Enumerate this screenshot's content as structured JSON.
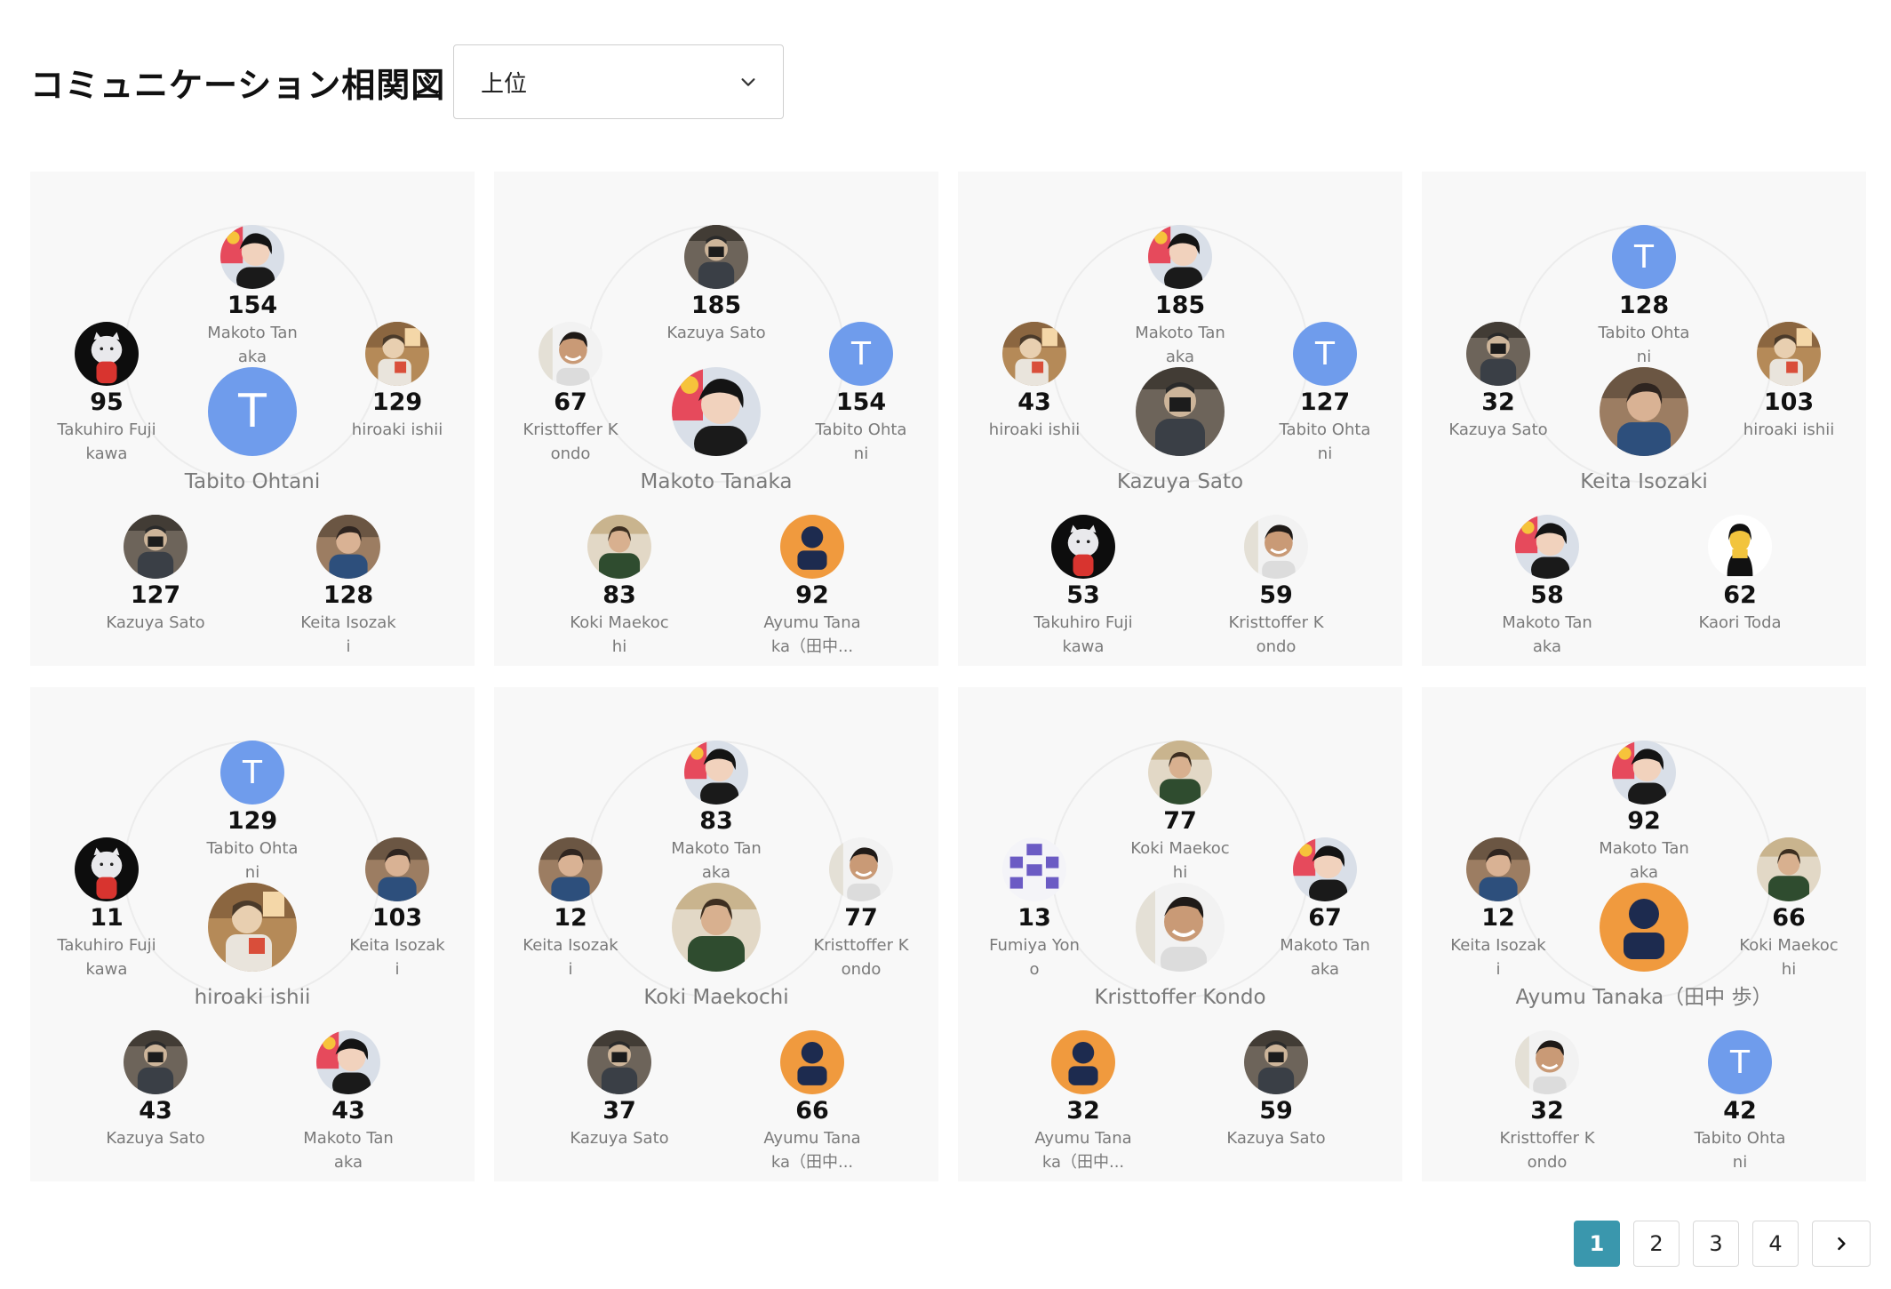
{
  "header": {
    "title": "コミュニケーション相関図",
    "select_value": "上位"
  },
  "cards": [
    {
      "center": {
        "name": "Tabito Ohtani",
        "avatar": "letter-T"
      },
      "nodes": [
        {
          "count": "154",
          "name": "Makoto Tanaka",
          "avatar": "photo-makoto"
        },
        {
          "count": "129",
          "name": "hiroaki ishii",
          "avatar": "photo-hiroaki"
        },
        {
          "count": "128",
          "name": "Keita Isozaki",
          "avatar": "photo-keita"
        },
        {
          "count": "127",
          "name": "Kazuya Sato",
          "avatar": "photo-kazuya"
        },
        {
          "count": "95",
          "name": "Takuhiro Fujikawa",
          "avatar": "photo-takuhiro"
        }
      ]
    },
    {
      "center": {
        "name": "Makoto Tanaka",
        "avatar": "photo-makoto"
      },
      "nodes": [
        {
          "count": "185",
          "name": "Kazuya Sato",
          "avatar": "photo-kazuya"
        },
        {
          "count": "154",
          "name": "Tabito Ohtani",
          "avatar": "letter-T"
        },
        {
          "count": "92",
          "name": "Ayumu Tanaka（田中...",
          "avatar": "person-orange"
        },
        {
          "count": "83",
          "name": "Koki Maekochi",
          "avatar": "photo-koki"
        },
        {
          "count": "67",
          "name": "Kristtoffer Kondo",
          "avatar": "photo-kristtoffer"
        }
      ]
    },
    {
      "center": {
        "name": "Kazuya Sato",
        "avatar": "photo-kazuya"
      },
      "nodes": [
        {
          "count": "185",
          "name": "Makoto Tanaka",
          "avatar": "photo-makoto"
        },
        {
          "count": "127",
          "name": "Tabito Ohtani",
          "avatar": "letter-T"
        },
        {
          "count": "59",
          "name": "Kristtoffer Kondo",
          "avatar": "photo-kristtoffer"
        },
        {
          "count": "53",
          "name": "Takuhiro Fujikawa",
          "avatar": "photo-takuhiro"
        },
        {
          "count": "43",
          "name": "hiroaki ishii",
          "avatar": "photo-hiroaki"
        }
      ]
    },
    {
      "center": {
        "name": "Keita Isozaki",
        "avatar": "photo-keita"
      },
      "nodes": [
        {
          "count": "128",
          "name": "Tabito Ohtani",
          "avatar": "letter-T"
        },
        {
          "count": "103",
          "name": "hiroaki ishii",
          "avatar": "photo-hiroaki"
        },
        {
          "count": "62",
          "name": "Kaori Toda",
          "avatar": "photo-kaori"
        },
        {
          "count": "58",
          "name": "Makoto Tanaka",
          "avatar": "photo-makoto"
        },
        {
          "count": "32",
          "name": "Kazuya Sato",
          "avatar": "photo-kazuya"
        }
      ]
    },
    {
      "center": {
        "name": "hiroaki ishii",
        "avatar": "photo-hiroaki"
      },
      "nodes": [
        {
          "count": "129",
          "name": "Tabito Ohtani",
          "avatar": "letter-T"
        },
        {
          "count": "103",
          "name": "Keita Isozaki",
          "avatar": "photo-keita"
        },
        {
          "count": "43",
          "name": "Makoto Tanaka",
          "avatar": "photo-makoto"
        },
        {
          "count": "43",
          "name": "Kazuya Sato",
          "avatar": "photo-kazuya"
        },
        {
          "count": "11",
          "name": "Takuhiro Fujikawa",
          "avatar": "photo-takuhiro"
        }
      ]
    },
    {
      "center": {
        "name": "Koki Maekochi",
        "avatar": "photo-koki"
      },
      "nodes": [
        {
          "count": "83",
          "name": "Makoto Tanaka",
          "avatar": "photo-makoto"
        },
        {
          "count": "77",
          "name": "Kristtoffer Kondo",
          "avatar": "photo-kristtoffer"
        },
        {
          "count": "66",
          "name": "Ayumu Tanaka（田中...",
          "avatar": "person-orange"
        },
        {
          "count": "37",
          "name": "Kazuya Sato",
          "avatar": "photo-kazuya"
        },
        {
          "count": "12",
          "name": "Keita Isozaki",
          "avatar": "photo-keita"
        }
      ]
    },
    {
      "center": {
        "name": "Kristtoffer Kondo",
        "avatar": "photo-kristtoffer"
      },
      "nodes": [
        {
          "count": "77",
          "name": "Koki Maekochi",
          "avatar": "photo-koki"
        },
        {
          "count": "67",
          "name": "Makoto Tanaka",
          "avatar": "photo-makoto"
        },
        {
          "count": "59",
          "name": "Kazuya Sato",
          "avatar": "photo-kazuya"
        },
        {
          "count": "32",
          "name": "Ayumu Tanaka（田中...",
          "avatar": "person-orange"
        },
        {
          "count": "13",
          "name": "Fumiya Yono",
          "avatar": "pattern-purple"
        }
      ]
    },
    {
      "center": {
        "name": "Ayumu Tanaka（田中 歩）",
        "avatar": "person-orange"
      },
      "nodes": [
        {
          "count": "92",
          "name": "Makoto Tanaka",
          "avatar": "photo-makoto"
        },
        {
          "count": "66",
          "name": "Koki Maekochi",
          "avatar": "photo-koki"
        },
        {
          "count": "42",
          "name": "Tabito Ohtani",
          "avatar": "letter-T"
        },
        {
          "count": "32",
          "name": "Kristtoffer Kondo",
          "avatar": "photo-kristtoffer"
        },
        {
          "count": "12",
          "name": "Keita Isozaki",
          "avatar": "photo-keita"
        }
      ]
    }
  ],
  "pagination": {
    "pages": [
      "1",
      "2",
      "3",
      "4"
    ],
    "current": "1",
    "next_icon": "chevron-right-icon"
  },
  "colors": {
    "accent": "#3a97ad",
    "avatar_letter_bg": "#6f9cec",
    "person_orange": "#f09a3e",
    "person_navy": "#1d2b4f"
  }
}
